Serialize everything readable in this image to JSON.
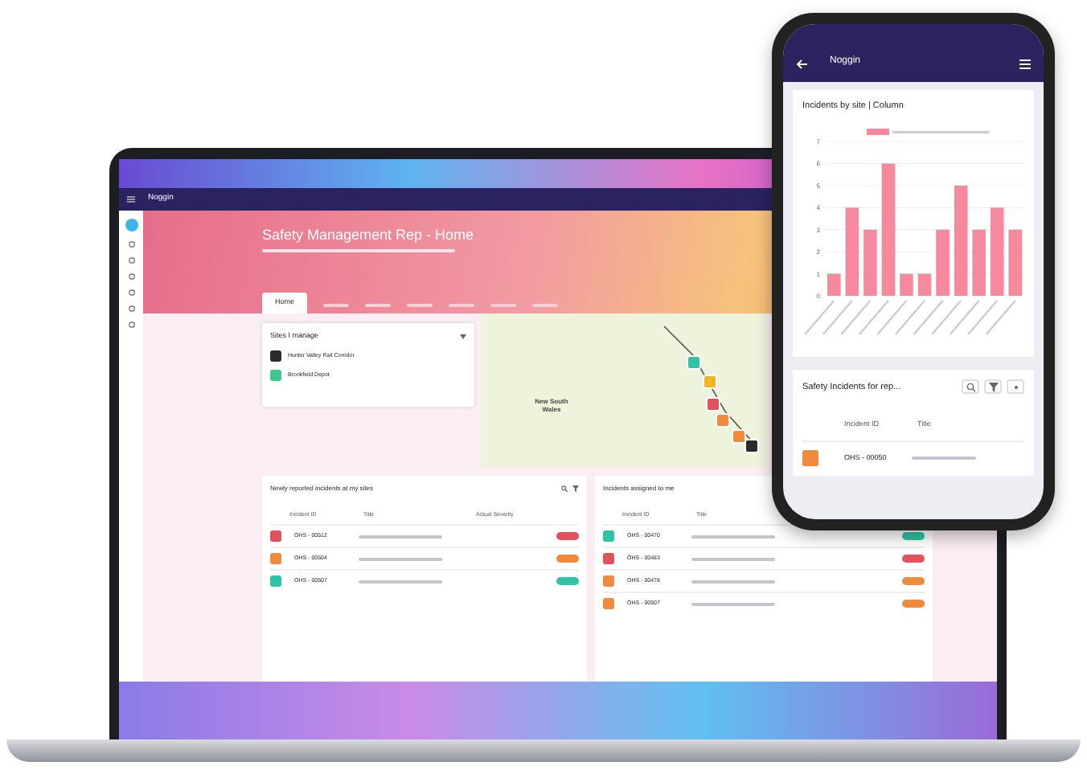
{
  "laptop": {
    "app_name": "Noggin",
    "page_title": "Safety Management Rep - Home",
    "tabs": [
      {
        "label": "Home",
        "selected": true
      }
    ],
    "sites_card": {
      "title": "Sites I manage",
      "items": [
        {
          "label": "Hunter Valley Rail Corridor",
          "color": "#2b2b2b"
        },
        {
          "label": "Brookfield Depot",
          "color": "#3cc98b"
        }
      ]
    },
    "map": {
      "region_label": "New South Wales",
      "markers": [
        {
          "color": "#2ec4a5"
        },
        {
          "color": "#f2b51c"
        },
        {
          "color": "#e2525c"
        },
        {
          "color": "#f08a3c"
        },
        {
          "color": "#f08a3c"
        },
        {
          "color": "#2b2b2b"
        }
      ]
    },
    "incident_cards": [
      {
        "title": "Newly reported incidents at my sites",
        "columns": [
          "Incident ID",
          "Title",
          "Actual Severity"
        ],
        "rows": [
          {
            "id": "OHS - 00512",
            "color": "#e2525c"
          },
          {
            "id": "OHS - 00504",
            "color": "#f08a3c"
          },
          {
            "id": "OHS - 00507",
            "color": "#2ec4a5"
          }
        ]
      },
      {
        "title": "Incidents assigned to me",
        "columns": [
          "Incident ID",
          "Title"
        ],
        "rows": [
          {
            "id": "OHS - 00470",
            "color": "#2ec4a5"
          },
          {
            "id": "OHS - 00483",
            "color": "#e2525c"
          },
          {
            "id": "OHS - 00478",
            "color": "#f08a3c"
          },
          {
            "id": "OHS - 00507",
            "color": "#f08a3c"
          }
        ]
      }
    ]
  },
  "phone": {
    "app_name": "Noggin",
    "chart_card": {
      "title": "Incidents by site | Column",
      "chart_data": {
        "type": "bar",
        "grid": true,
        "ylim": [
          0,
          7
        ],
        "yticks": [
          0,
          1,
          2,
          3,
          4,
          5,
          6,
          7
        ],
        "series": [
          {
            "color": "#f7899f",
            "values": [
              1,
              4,
              3,
              6,
              1,
              1,
              3,
              5,
              3,
              4,
              3
            ]
          }
        ]
      }
    },
    "table_card": {
      "title": "Safety Incidents for rep...",
      "columns": [
        "Incident ID",
        "Title"
      ],
      "rows": [
        {
          "id": "OHS - 00050",
          "color": "#f08a3c"
        }
      ]
    }
  }
}
